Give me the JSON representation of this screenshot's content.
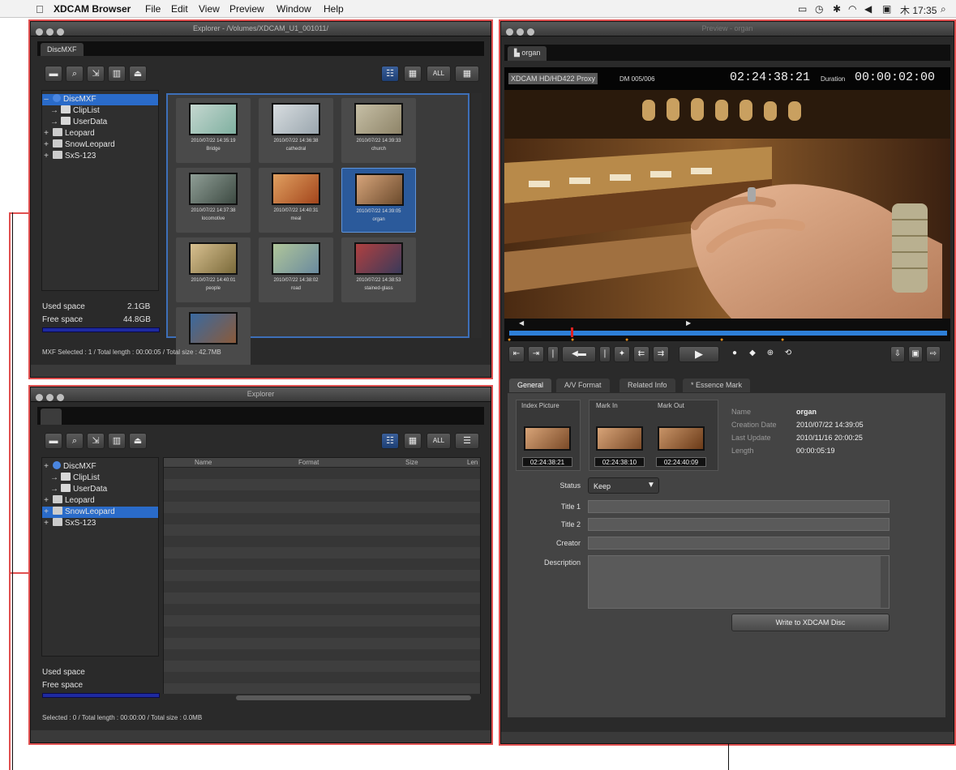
{
  "menubar": {
    "app_name": "XDCAM Browser",
    "menus": [
      "File",
      "Edit",
      "View",
      "Preview",
      "Window",
      "Help"
    ],
    "clock": "木 17:35"
  },
  "explorer_top": {
    "title": "Explorer - /Volumes/XDCAM_U1_001011/",
    "tab": "DiscMXF",
    "tree": [
      {
        "label": "DiscMXF",
        "expander": "–",
        "icon": "disc-icon",
        "selected": true
      },
      {
        "label": "ClipList",
        "expander": "→",
        "icon": "folder-icon"
      },
      {
        "label": "UserData",
        "expander": "→",
        "icon": "folder-icon"
      },
      {
        "label": "Leopard",
        "expander": "+",
        "icon": "drive-icon"
      },
      {
        "label": "SnowLeopard",
        "expander": "+",
        "icon": "drive-icon"
      },
      {
        "label": "SxS-123",
        "expander": "+",
        "icon": "card-icon"
      }
    ],
    "used_space_label": "Used space",
    "used_space_value": "2.1GB",
    "free_space_label": "Free space",
    "free_space_value": "44.8GB",
    "clips": [
      {
        "date": "2010/07/22 14:35:19",
        "name": "Bridge",
        "c1": "#7fb0a0",
        "c2": "#c5d7d0"
      },
      {
        "date": "2010/07/22 14:36:38",
        "name": "cathedral",
        "c1": "#9aa6ae",
        "c2": "#d8dde0"
      },
      {
        "date": "2010/07/22 14:39:33",
        "name": "church",
        "c1": "#8e8468",
        "c2": "#c6bfa6"
      },
      {
        "date": "2010/07/22 14:37:38",
        "name": "locomotive",
        "c1": "#3d4a42",
        "c2": "#8f9e96"
      },
      {
        "date": "2010/07/22 14:40:31",
        "name": "meal",
        "c1": "#a3451c",
        "c2": "#e0a060"
      },
      {
        "date": "2010/07/22 14:39:05",
        "name": "organ",
        "c1": "#6b4a2c",
        "c2": "#d6a47a",
        "selected": true
      },
      {
        "date": "2010/07/22 14:40:01",
        "name": "people",
        "c1": "#7a6a3a",
        "c2": "#d8c090"
      },
      {
        "date": "2010/07/22 14:38:02",
        "name": "road",
        "c1": "#6a8a9e",
        "c2": "#b0c69a"
      },
      {
        "date": "2010/07/22 14:38:53",
        "name": "stained-glass",
        "c1": "#3a3a5a",
        "c2": "#b04040"
      },
      {
        "date": "",
        "name": "",
        "c1": "#8a5a3a",
        "c2": "#3a6aa0"
      }
    ],
    "status": "MXF  Selected : 1 / Total length : 00:00:05 / Total size : 42.7MB"
  },
  "explorer_bottom": {
    "title": "Explorer",
    "tree": [
      {
        "label": "DiscMXF",
        "expander": "+",
        "icon": "disc-icon"
      },
      {
        "label": "ClipList",
        "expander": "→",
        "icon": "folder-icon"
      },
      {
        "label": "UserData",
        "expander": "→",
        "icon": "folder-icon"
      },
      {
        "label": "Leopard",
        "expander": "+",
        "icon": "drive-icon"
      },
      {
        "label": "SnowLeopard",
        "expander": "+",
        "icon": "drive-icon",
        "selected": true
      },
      {
        "label": "SxS-123",
        "expander": "+",
        "icon": "card-icon"
      }
    ],
    "columns": [
      "Name",
      "Format",
      "Size",
      "Len"
    ],
    "used_space_label": "Used space",
    "free_space_label": "Free space",
    "status": "Selected : 0 / Total length : 00:00:00 / Total size : 0.0MB"
  },
  "toolbar": {
    "all_label": "ALL"
  },
  "preview": {
    "title": "Preview - organ",
    "tab": "organ",
    "format_badge": "XDCAM HD/HD422 Proxy",
    "disc_index": "DM 005/006",
    "timecode": "02:24:38:21",
    "duration_label": "Duration",
    "duration_value": "00:00:02:00",
    "info_tabs": [
      "General",
      "A/V Format",
      "Related Info",
      "* Essence Mark"
    ],
    "index_picture_label": "Index Picture",
    "mark_in_label": "Mark In",
    "mark_out_label": "Mark Out",
    "index_tc": "02:24:38:21",
    "mark_in_tc": "02:24:38:10",
    "mark_out_tc": "02:24:40:09",
    "meta": [
      {
        "key": "Name",
        "value": "organ"
      },
      {
        "key": "Creation Date",
        "value": "2010/07/22 14:39:05"
      },
      {
        "key": "Last Update",
        "value": "2010/11/16 20:00:25"
      },
      {
        "key": "Length",
        "value": "00:00:05:19"
      }
    ],
    "status_label": "Status",
    "status_value": "Keep",
    "title1_label": "Title 1",
    "title2_label": "Title 2",
    "creator_label": "Creator",
    "description_label": "Description",
    "write_button": "Write to XDCAM Disc"
  }
}
